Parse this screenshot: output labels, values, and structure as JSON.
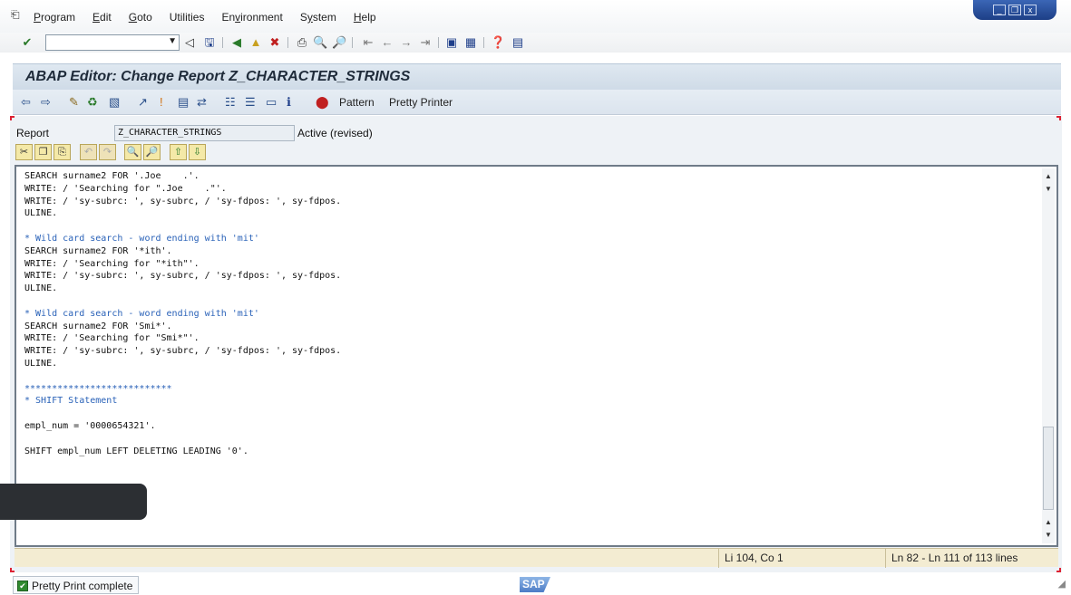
{
  "menubar": {
    "items": [
      {
        "label": "Program",
        "u": "P"
      },
      {
        "label": "Edit",
        "u": "E"
      },
      {
        "label": "Goto",
        "u": "G"
      },
      {
        "label": "Utilities",
        "u": ""
      },
      {
        "label": "Environment",
        "u": "v"
      },
      {
        "label": "System",
        "u": "y"
      },
      {
        "label": "Help",
        "u": "H"
      }
    ]
  },
  "window": {
    "title": "ABAP Editor: Change Report Z_CHARACTER_STRINGS"
  },
  "app_toolbar": {
    "pattern_label": "Pattern",
    "pretty_printer_label": "Pretty Printer"
  },
  "report": {
    "label": "Report",
    "value": "Z_CHARACTER_STRINGS",
    "status": "Active (revised)"
  },
  "editor": {
    "lines": [
      {
        "t": "SEARCH surname2 FOR '.Joe    .'.",
        "c": false
      },
      {
        "t": "WRITE: / 'Searching for \".Joe    .\"'.",
        "c": false
      },
      {
        "t": "WRITE: / 'sy-subrc: ', sy-subrc, / 'sy-fdpos: ', sy-fdpos.",
        "c": false
      },
      {
        "t": "ULINE.",
        "c": false
      },
      {
        "t": "",
        "c": false
      },
      {
        "t": "* Wild card search - word ending with 'mit'",
        "c": true
      },
      {
        "t": "SEARCH surname2 FOR '*ith'.",
        "c": false
      },
      {
        "t": "WRITE: / 'Searching for \"*ith\"'.",
        "c": false
      },
      {
        "t": "WRITE: / 'sy-subrc: ', sy-subrc, / 'sy-fdpos: ', sy-fdpos.",
        "c": false
      },
      {
        "t": "ULINE.",
        "c": false
      },
      {
        "t": "",
        "c": false
      },
      {
        "t": "* Wild card search - word ending with 'mit'",
        "c": true
      },
      {
        "t": "SEARCH surname2 FOR 'Smi*'.",
        "c": false
      },
      {
        "t": "WRITE: / 'Searching for \"Smi*\"'.",
        "c": false
      },
      {
        "t": "WRITE: / 'sy-subrc: ', sy-subrc, / 'sy-fdpos: ', sy-fdpos.",
        "c": false
      },
      {
        "t": "ULINE.",
        "c": false
      },
      {
        "t": "",
        "c": false
      },
      {
        "t": "***************************",
        "c": true
      },
      {
        "t": "* SHIFT Statement",
        "c": true
      },
      {
        "t": "",
        "c": false
      },
      {
        "t": "empl_num = '0000654321'.",
        "c": false
      },
      {
        "t": "",
        "c": false
      },
      {
        "t": "SHIFT empl_num LEFT DELETING LEADING '0'.",
        "c": false
      }
    ]
  },
  "status": {
    "cursor": "Li 104, Co 1",
    "range": "Ln 82 - Ln 111 of 113 lines"
  },
  "message": {
    "text": "Pretty Print complete"
  },
  "logo": {
    "text": "SAP"
  }
}
